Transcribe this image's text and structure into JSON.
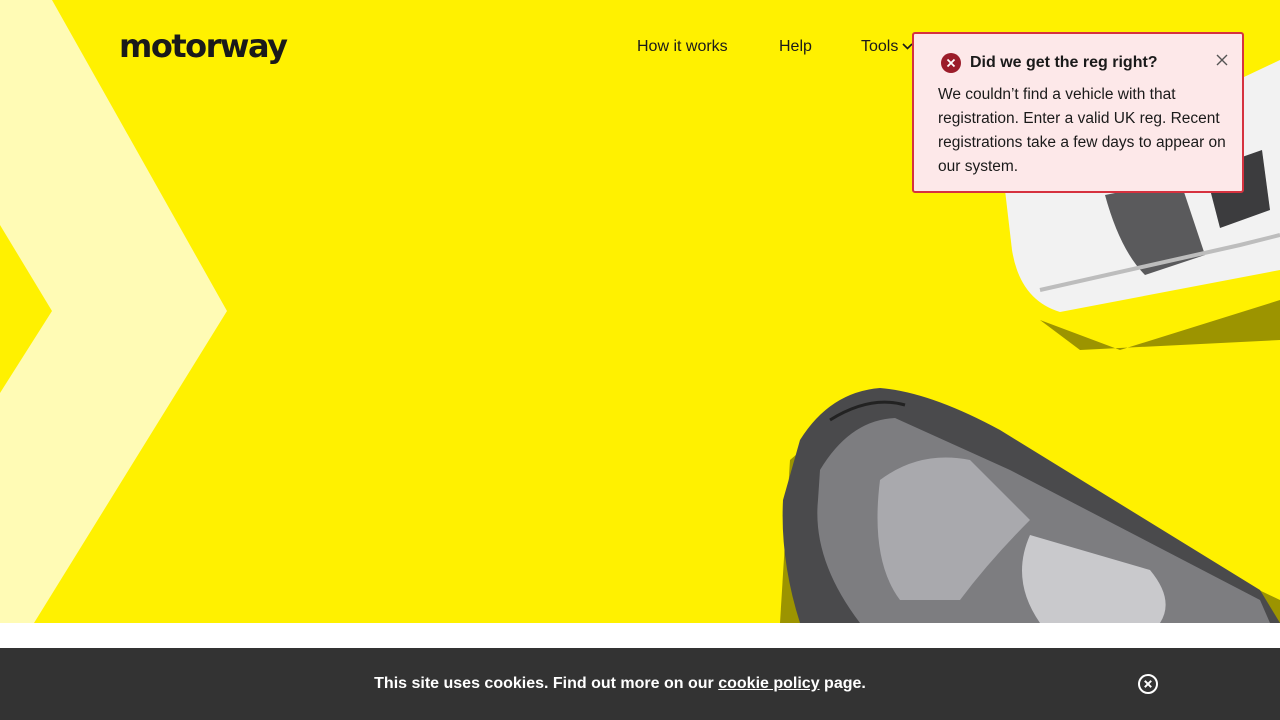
{
  "brand": {
    "logo_text": "motorway",
    "colors": {
      "hero_yellow": "#fff100",
      "chevron": "#fffbb5",
      "toast_bg": "#fde8e9",
      "toast_border": "#d6323f",
      "cookie_bg": "#333333"
    }
  },
  "nav": {
    "items": [
      {
        "label": "How it works"
      },
      {
        "label": "Help"
      },
      {
        "label": "Tools",
        "icon": "chevron-down-icon"
      }
    ]
  },
  "toast": {
    "icon": "error-icon",
    "title": "Did we get the reg right?",
    "message": "We couldn’t find a vehicle with that registration. Enter a valid UK reg. Recent registrations take a few days to appear on our system.",
    "close_icon": "close-icon"
  },
  "cookie_bar": {
    "text_before": "This site uses cookies. Find out more on our ",
    "link_label": "cookie policy",
    "text_after": " page.",
    "close_icon": "close-circle-icon"
  }
}
